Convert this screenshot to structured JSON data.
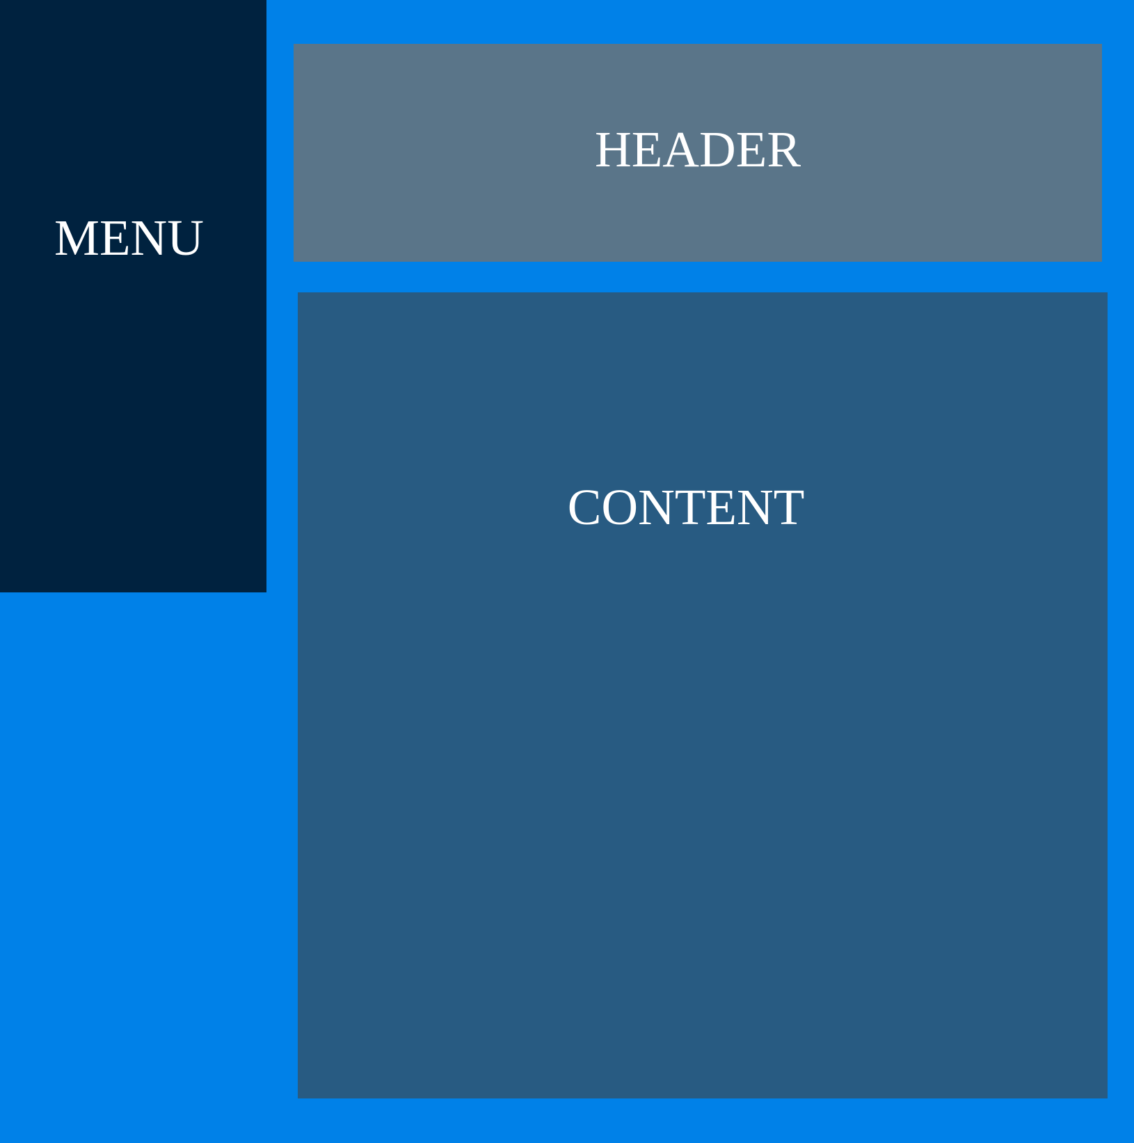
{
  "menu": {
    "label": "MENU"
  },
  "header": {
    "label": "HEADER"
  },
  "content": {
    "label": "CONTENT"
  },
  "colors": {
    "background": "#0081E8",
    "menu": "#00223F",
    "header": "#5A7589",
    "content": "#285B82",
    "text": "#FFFFFF"
  }
}
